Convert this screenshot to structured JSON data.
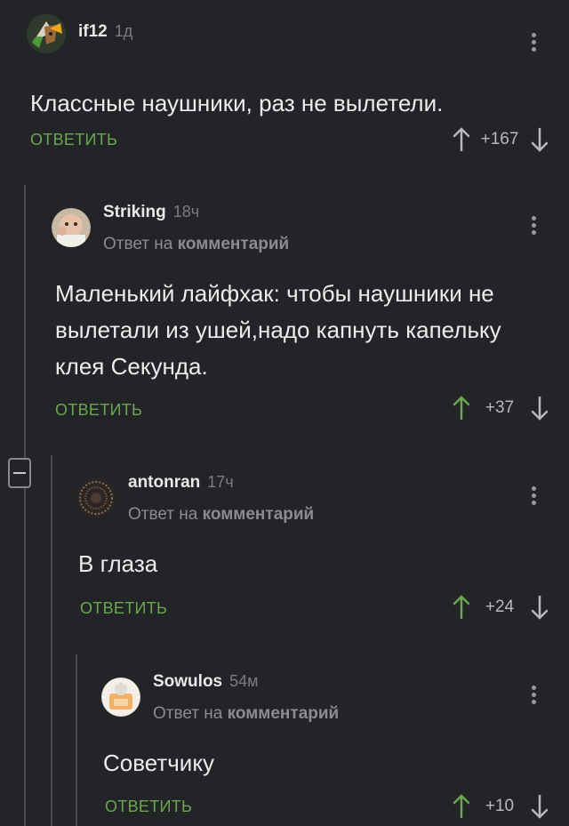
{
  "comments": [
    {
      "author": "if12",
      "time": "1д",
      "reply_prefix": "",
      "reply_link": "",
      "text": "Классные наушники, раз не вылетели.",
      "reply_label": "ОТВЕТИТЬ",
      "score": "+167",
      "upvoted": false
    },
    {
      "author": "Striking",
      "time": "18ч",
      "reply_prefix": "Ответ на",
      "reply_link": "комментарий",
      "text": "Маленький лайфхак: чтобы наушники не вылетали из ушей,надо капнуть капельку клея Секунда.",
      "reply_label": "ОТВЕТИТЬ",
      "score": "+37",
      "upvoted": true
    },
    {
      "author": "antonran",
      "time": "17ч",
      "reply_prefix": "Ответ на",
      "reply_link": "комментарий",
      "text": "В глаза",
      "reply_label": "ОТВЕТИТЬ",
      "score": "+24",
      "upvoted": true
    },
    {
      "author": "Sowulos",
      "time": "54м",
      "reply_prefix": "Ответ на",
      "reply_link": "комментарий",
      "text": "Советчику",
      "reply_label": "ОТВЕТИТЬ",
      "score": "+10",
      "upvoted": true
    }
  ],
  "colors": {
    "background": "#232427",
    "reply_green": "#69a84d",
    "upvote_green": "#69a84d",
    "muted": "#8b8c8f"
  }
}
